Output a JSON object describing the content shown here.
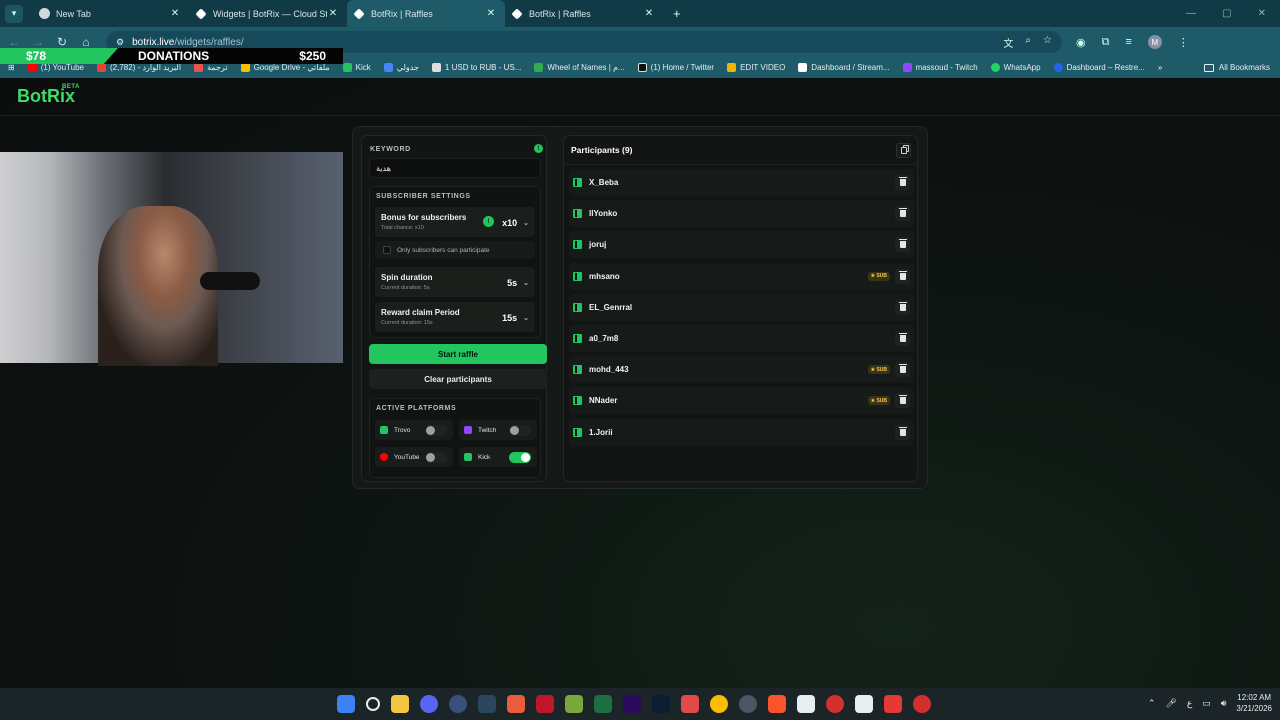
{
  "browser": {
    "tabs": [
      {
        "title": "New Tab",
        "active": false
      },
      {
        "title": "Widgets | BotRix — Cloud Strea",
        "active": false
      },
      {
        "title": "BotRix | Raffles",
        "active": true
      },
      {
        "title": "BotRix | Raffles",
        "active": false
      }
    ],
    "url_host": "botrix.live",
    "url_path": "/widgets/raffles/",
    "bookmarks": [
      "(1) YouTube",
      "البريد الوارد - (2,782)",
      "ترجمة",
      "Google Drive - ملفاتي",
      "Kick",
      "جدولي",
      "1 USD to RUB - US...",
      "Wheel of Names | م...",
      "(1) Home / Twitter",
      "EDIT VIDEO",
      "Dashboard / Stream...",
      "massoud - Twitch",
      "WhatsApp",
      "Dashboard – Restre..."
    ],
    "all_bookmarks": "All Bookmarks",
    "avatar_initial": "M"
  },
  "app": {
    "logo": "BotRix",
    "beta": "BETA"
  },
  "donations": {
    "left": "$78",
    "title": "DONATIONS",
    "right": "$250"
  },
  "raffle": {
    "keyword_title": "KEYWORD",
    "keyword_value": "هدية",
    "subscriber_settings_title": "SUBSCRIBER SETTINGS",
    "bonus_title": "Bonus for subscribers",
    "bonus_sub": "Total chance: x10",
    "bonus_value": "x10",
    "only_subs_label": "Only subscribers can participate",
    "only_subs_checked": false,
    "spin_title": "Spin duration",
    "spin_sub": "Current duration: 5s",
    "spin_value": "5s",
    "claim_title": "Reward claim Period",
    "claim_sub": "Current duration: 15s",
    "claim_value": "15s",
    "start_button": "Start raffle",
    "clear_button": "Clear participants",
    "platforms_title": "ACTIVE PLATFORMS",
    "platforms": [
      {
        "name": "Trovo",
        "enabled": false,
        "color": "#22c55e"
      },
      {
        "name": "Twitch",
        "enabled": false,
        "color": "#9146ff"
      },
      {
        "name": "YouTube",
        "enabled": false,
        "color": "#ff0000"
      },
      {
        "name": "Kick",
        "enabled": true,
        "color": "#22c55e"
      }
    ]
  },
  "participants": {
    "title": "Participants (9)",
    "sub_badge": "SUB",
    "list": [
      {
        "name": "X_Beba",
        "sub": false
      },
      {
        "name": "llYonko",
        "sub": false
      },
      {
        "name": "joruj",
        "sub": false
      },
      {
        "name": "mhsano",
        "sub": true
      },
      {
        "name": "EL_Genrral",
        "sub": false
      },
      {
        "name": "a0_7m8",
        "sub": false
      },
      {
        "name": "mohd_443",
        "sub": true
      },
      {
        "name": "NNader",
        "sub": true
      },
      {
        "name": "1.Jorii",
        "sub": false
      }
    ]
  },
  "taskbar": {
    "time": "12:02 AM",
    "date": "3/21/2026",
    "lang": "ع"
  }
}
